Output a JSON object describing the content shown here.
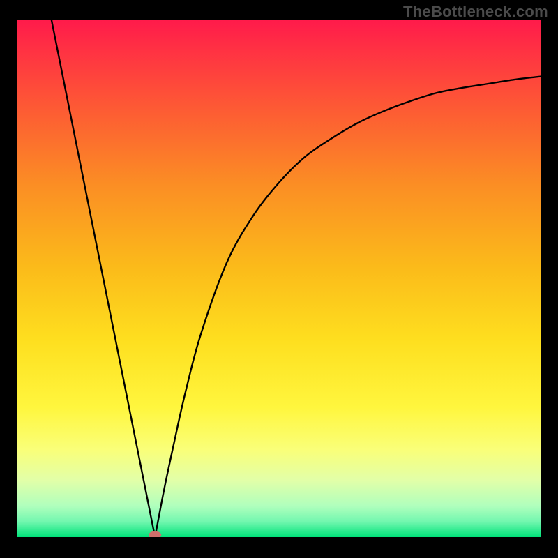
{
  "watermark": "TheBottleneck.com",
  "chart_data": {
    "type": "line",
    "title": "",
    "xlabel": "",
    "ylabel": "",
    "xlim": [
      0,
      1
    ],
    "ylim": [
      0,
      1
    ],
    "v_shape": {
      "left_line": {
        "x_top": 0.065,
        "y_top": 1.0,
        "x_bottom": 0.263,
        "y_bottom": 0.0
      },
      "min_point": {
        "x": 0.263,
        "y": 0.0
      },
      "right_curve": {
        "x_start": 0.263,
        "y_start": 0.0,
        "x_end": 1.0,
        "y_end": 0.89,
        "xs": [
          0.263,
          0.28,
          0.3,
          0.32,
          0.35,
          0.4,
          0.45,
          0.5,
          0.55,
          0.6,
          0.65,
          0.7,
          0.75,
          0.8,
          0.85,
          0.9,
          0.95,
          1.0
        ],
        "ys": [
          0.0,
          0.09,
          0.185,
          0.275,
          0.39,
          0.53,
          0.62,
          0.685,
          0.735,
          0.77,
          0.8,
          0.823,
          0.842,
          0.858,
          0.868,
          0.876,
          0.884,
          0.89
        ]
      }
    },
    "marker": {
      "x": 0.263,
      "y": 0.0,
      "rx": 0.012,
      "ry": 0.0075,
      "color": "#cf6f6b"
    },
    "gradient_stops": [
      {
        "offset": 0.0,
        "color": "#ff1a4b"
      },
      {
        "offset": 0.05,
        "color": "#ff2e44"
      },
      {
        "offset": 0.18,
        "color": "#fd5d33"
      },
      {
        "offset": 0.32,
        "color": "#fb8e24"
      },
      {
        "offset": 0.48,
        "color": "#fbbb1a"
      },
      {
        "offset": 0.62,
        "color": "#fedf1f"
      },
      {
        "offset": 0.75,
        "color": "#fff63e"
      },
      {
        "offset": 0.83,
        "color": "#faff78"
      },
      {
        "offset": 0.89,
        "color": "#e2ffa8"
      },
      {
        "offset": 0.94,
        "color": "#b0ffbd"
      },
      {
        "offset": 0.97,
        "color": "#72f7af"
      },
      {
        "offset": 1.0,
        "color": "#00e37a"
      }
    ]
  }
}
